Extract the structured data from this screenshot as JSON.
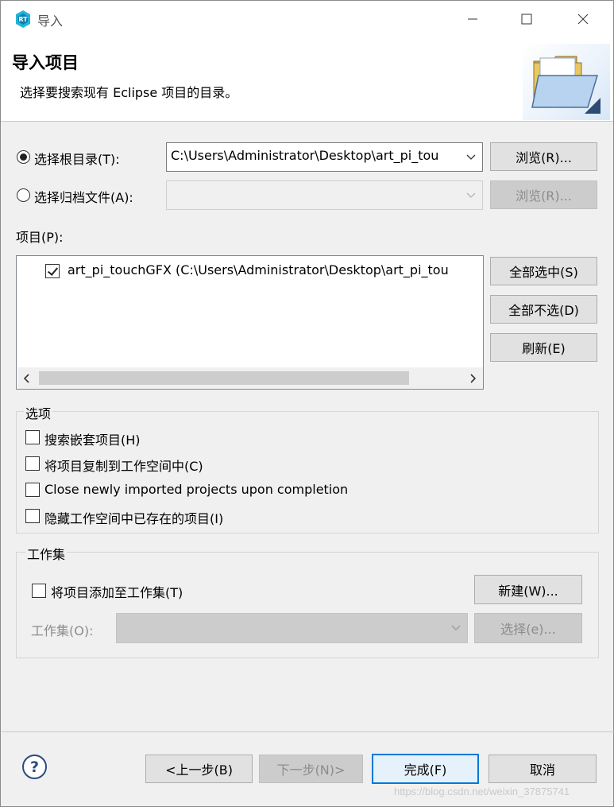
{
  "window": {
    "title": "导入"
  },
  "banner": {
    "title": "导入项目",
    "description": "选择要搜索现有 Eclipse 项目的目录。"
  },
  "source": {
    "root_dir": {
      "label": "选择根目录(T):",
      "value": "C:\\Users\\Administrator\\Desktop\\art_pi_tou",
      "selected": true,
      "browse_label": "浏览(R)..."
    },
    "archive": {
      "label": "选择归档文件(A):",
      "value": "",
      "selected": false,
      "browse_label": "浏览(R)..."
    }
  },
  "projects": {
    "label": "项目(P):",
    "items": [
      {
        "text": "art_pi_touchGFX  (C:\\Users\\Administrator\\Desktop\\art_pi_tou",
        "checked": true
      }
    ],
    "select_all_label": "全部选中(S)",
    "deselect_all_label": "全部不选(D)",
    "refresh_label": "刷新(E)"
  },
  "options": {
    "title": "选项",
    "items": [
      {
        "label": "搜索嵌套项目(H)",
        "checked": false
      },
      {
        "label": "将项目复制到工作空间中(C)",
        "checked": false
      },
      {
        "label": "Close newly imported projects upon completion",
        "checked": false
      },
      {
        "label": "隐藏工作空间中已存在的项目(I)",
        "checked": false
      }
    ]
  },
  "working_sets": {
    "title": "工作集",
    "add_label": "将项目添加至工作集(T)",
    "add_checked": false,
    "new_label": "新建(W)...",
    "sets_label": "工作集(O):",
    "sets_value": "",
    "select_label": "选择(e)..."
  },
  "footer": {
    "help_symbol": "?",
    "back_label": "<上一步(B)",
    "next_label": "下一步(N)>",
    "finish_label": "完成(F)",
    "cancel_label": "取消"
  },
  "watermark": "https://blog.csdn.net/weixin_37875741",
  "colors": {
    "accent": "#0078d7",
    "disabled_text": "#8c8c8c",
    "window_bg": "#f0f0f0"
  },
  "icons": {
    "app": "rt-thread-logo-icon",
    "banner": "open-folder-icon",
    "help": "help-icon"
  }
}
